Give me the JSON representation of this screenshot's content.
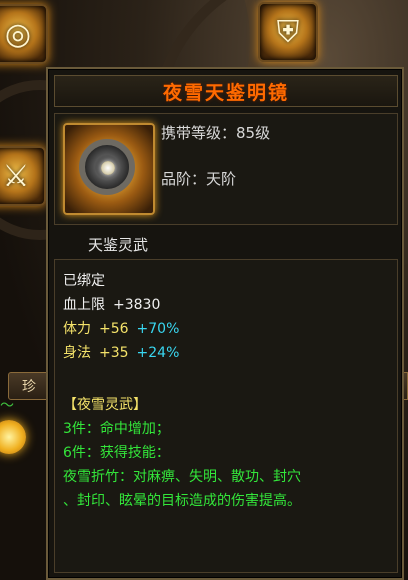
{
  "background": {
    "left_tab_label": "珍",
    "slot_icons": [
      "compass-icon",
      "armor-icon",
      "sword-icon"
    ]
  },
  "tooltip": {
    "title": "夜雪天鉴明镜",
    "level_requirement": "携带等级：85级",
    "grade": "品阶：天阶",
    "subtitle": "天鉴灵武",
    "bound_status": "已绑定",
    "stats": [
      {
        "label": "血上限",
        "value": "+3830",
        "bonus": ""
      },
      {
        "label": "体力",
        "value": "+56",
        "bonus": "+70%"
      },
      {
        "label": "身法",
        "value": "+35",
        "bonus": "+24%"
      }
    ],
    "set_name": "【夜雪灵武】",
    "set_lines": [
      "3件：命中增加；",
      "6件：获得技能：",
      "夜雪折竹：对麻痹、失明、散功、封穴",
      "、封印、眩晕的目标造成的伤害提高。"
    ]
  },
  "colors": {
    "title": "#ff6a00",
    "stat_yellow": "#f5e36a",
    "bonus_cyan": "#39d6f0",
    "set_green": "#33e63a"
  }
}
